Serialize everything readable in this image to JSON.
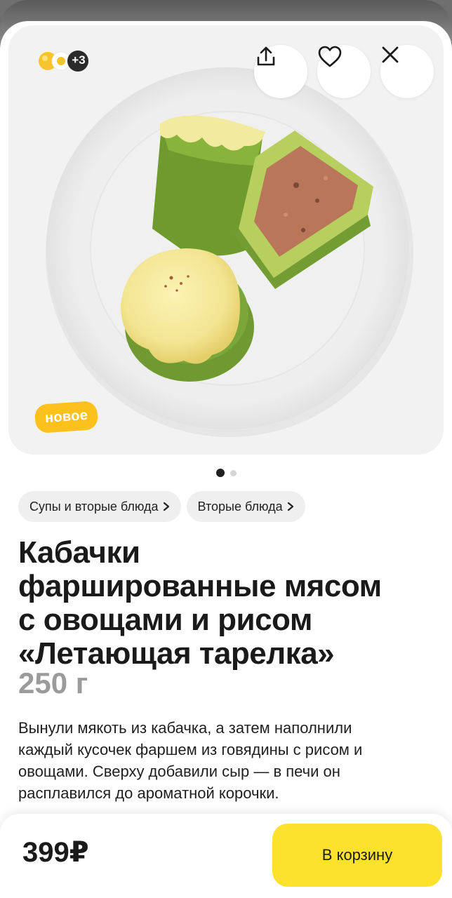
{
  "colors": {
    "accent_yellow": "#fde22d",
    "badge_orange": "#fcc21b",
    "chip_bg": "#efefef",
    "muted_text": "#9b9b9b"
  },
  "hero": {
    "partners_more": "+3",
    "badge": "новое",
    "actions": [
      {
        "name": "share",
        "icon": "share-icon"
      },
      {
        "name": "favorite",
        "icon": "heart-icon"
      },
      {
        "name": "close",
        "icon": "close-icon"
      }
    ],
    "carousel": {
      "total": 2,
      "current": 1
    }
  },
  "breadcrumbs": [
    {
      "label": "Супы и вторые блюда"
    },
    {
      "label": "Вторые блюда"
    }
  ],
  "product": {
    "title_lines": [
      "Кабачки",
      "фаршированные мясом",
      "с овощами и рисом",
      "«Летающая тарелка»"
    ],
    "weight": "250 г",
    "description_lines": [
      "Вынули мякоть из кабачка, а затем наполнили",
      "каждый кусочек фаршем из говядины с рисом и",
      "овощами. Сверху добавили сыр — в печи он",
      "расплавился до ароматной корочки."
    ]
  },
  "checkout": {
    "price": "399₽",
    "cart_label": "В корзину"
  }
}
